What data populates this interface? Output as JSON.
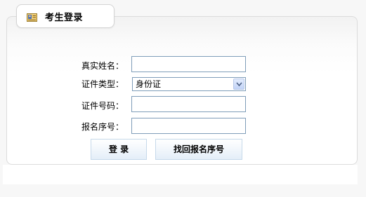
{
  "tab": {
    "title": "考生登录",
    "icon": "id-card-icon"
  },
  "form": {
    "name_label": "真实姓名：",
    "name_value": "",
    "id_type_label": "证件类型：",
    "id_type_value": "身份证",
    "id_number_label": "证件号码：",
    "id_number_value": "",
    "reg_number_label": "报名序号：",
    "reg_number_value": ""
  },
  "buttons": {
    "login_label": "登 录",
    "recover_label": "找回报名序号"
  },
  "colors": {
    "input_border": "#7f9db9",
    "button_border": "#c6d9ea",
    "panel_border": "#dcdcdc"
  }
}
